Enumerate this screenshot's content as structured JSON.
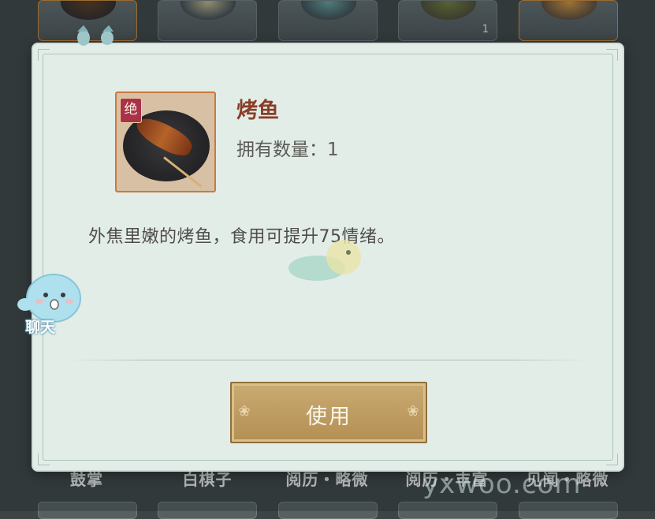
{
  "item": {
    "name": "烤鱼",
    "quantity_label": "拥有数量：1",
    "description": "外焦里嫩的烤鱼，食用可提升75情绪。",
    "rarity_badge": "绝",
    "icon": "grilled-fish-icon"
  },
  "actions": {
    "use_label": "使用"
  },
  "chat": {
    "label": "聊天"
  },
  "background_grid": {
    "top_row_counts": [
      "",
      "",
      "",
      "1",
      ""
    ],
    "labels": [
      "鼓掌",
      "白棋子",
      "阅历・略微",
      "阅历・丰富",
      "见闻・略微"
    ]
  },
  "watermark": "yxwoo.com",
  "colors": {
    "dialog_bg": "#e3ede8",
    "item_name": "#8a3e28",
    "button": "#c9ab72",
    "frame_accent": "#c97a3e"
  }
}
